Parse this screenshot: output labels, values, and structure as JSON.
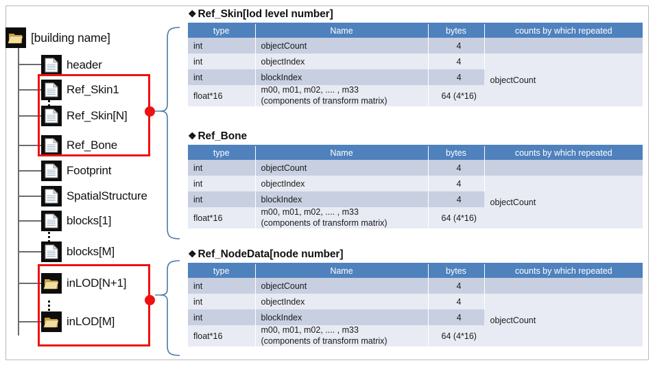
{
  "tree": {
    "root": {
      "label": "[building name]",
      "icon": "folder-icon"
    },
    "nodes": [
      {
        "label": "header",
        "icon": "document-icon"
      },
      {
        "label": "Ref_Skin1",
        "icon": "document-icon"
      },
      {
        "label": "Ref_Skin[N]",
        "icon": "document-icon"
      },
      {
        "label": "Ref_Bone",
        "icon": "document-icon"
      },
      {
        "label": "Footprint",
        "icon": "document-icon"
      },
      {
        "label": "SpatialStructure",
        "icon": "document-icon"
      },
      {
        "label": "blocks[1]",
        "icon": "document-icon"
      },
      {
        "label": "blocks[M]",
        "icon": "document-icon"
      },
      {
        "label": "inLOD[N+1]",
        "icon": "folder-icon"
      },
      {
        "label": "inLOD[M]",
        "icon": "folder-icon"
      }
    ],
    "highlight_color": "#ee1111"
  },
  "sections": [
    {
      "title": "Ref_Skin[lod level number]",
      "bullet": "❖",
      "columns": [
        "type",
        "Name",
        "bytes",
        "counts by which repeated"
      ],
      "rows": [
        {
          "type": "int",
          "name": "objectCount",
          "bytes": "4"
        },
        {
          "type": "int",
          "name": "objectIndex",
          "bytes": "4"
        },
        {
          "type": "int",
          "name": "blockIndex",
          "bytes": "4"
        },
        {
          "type": "float*16",
          "name": "m00, m01, m02, .... ,  m33",
          "name2": "(components of transform matrix)",
          "bytes": "64 (4*16)"
        }
      ],
      "repeated": "objectCount"
    },
    {
      "title": "Ref_Bone",
      "bullet": "❖",
      "columns": [
        "type",
        "Name",
        "bytes",
        "counts by which repeated"
      ],
      "rows": [
        {
          "type": "int",
          "name": "objectCount",
          "bytes": "4"
        },
        {
          "type": "int",
          "name": "objectIndex",
          "bytes": "4"
        },
        {
          "type": "int",
          "name": "blockIndex",
          "bytes": "4"
        },
        {
          "type": "float*16",
          "name": "m00, m01, m02, .... ,  m33",
          "name2": "(components of transform matrix)",
          "bytes": "64 (4*16)"
        }
      ],
      "repeated": "objectCount"
    },
    {
      "title": "Ref_NodeData[node number]",
      "bullet": "❖",
      "columns": [
        "type",
        "Name",
        "bytes",
        "counts by which repeated"
      ],
      "rows": [
        {
          "type": "int",
          "name": "objectCount",
          "bytes": "4"
        },
        {
          "type": "int",
          "name": "objectIndex",
          "bytes": "4"
        },
        {
          "type": "int",
          "name": "blockIndex",
          "bytes": "4"
        },
        {
          "type": "float*16",
          "name": "m00, m01, m02, .... ,  m33",
          "name2": "(components of transform matrix)",
          "bytes": "64 (4*16)"
        }
      ],
      "repeated": "objectCount"
    }
  ],
  "colors": {
    "header_blue": "#4f81bd",
    "row_dark": "#c7cfe0",
    "row_light": "#e8ebf3",
    "highlight_red": "#ee1111",
    "connector_blue": "#4a76a8"
  }
}
